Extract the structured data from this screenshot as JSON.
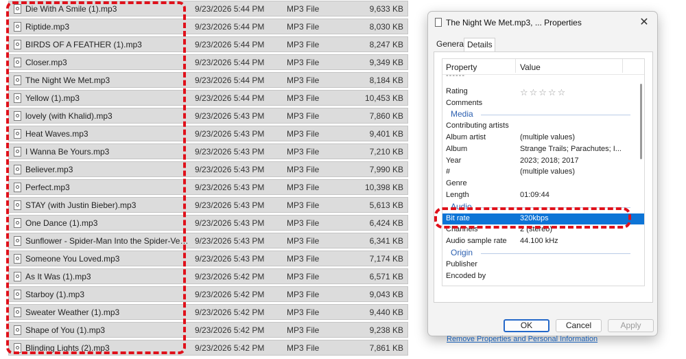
{
  "files": [
    {
      "name": "Die With A Smile (1).mp3",
      "date": "9/23/2026 5:44 PM",
      "type": "MP3 File",
      "size": "9,633 KB"
    },
    {
      "name": "Riptide.mp3",
      "date": "9/23/2026 5:44 PM",
      "type": "MP3 File",
      "size": "8,030 KB"
    },
    {
      "name": "BIRDS OF A FEATHER (1).mp3",
      "date": "9/23/2026 5:44 PM",
      "type": "MP3 File",
      "size": "8,247 KB"
    },
    {
      "name": "Closer.mp3",
      "date": "9/23/2026 5:44 PM",
      "type": "MP3 File",
      "size": "9,349 KB"
    },
    {
      "name": "The Night We Met.mp3",
      "date": "9/23/2026 5:44 PM",
      "type": "MP3 File",
      "size": "8,184 KB"
    },
    {
      "name": "Yellow (1).mp3",
      "date": "9/23/2026 5:44 PM",
      "type": "MP3 File",
      "size": "10,453 KB"
    },
    {
      "name": "lovely (with Khalid).mp3",
      "date": "9/23/2026 5:43 PM",
      "type": "MP3 File",
      "size": "7,860 KB"
    },
    {
      "name": "Heat Waves.mp3",
      "date": "9/23/2026 5:43 PM",
      "type": "MP3 File",
      "size": "9,401 KB"
    },
    {
      "name": "I Wanna Be Yours.mp3",
      "date": "9/23/2026 5:43 PM",
      "type": "MP3 File",
      "size": "7,210 KB"
    },
    {
      "name": "Believer.mp3",
      "date": "9/23/2026 5:43 PM",
      "type": "MP3 File",
      "size": "7,990 KB"
    },
    {
      "name": "Perfect.mp3",
      "date": "9/23/2026 5:43 PM",
      "type": "MP3 File",
      "size": "10,398 KB"
    },
    {
      "name": "STAY (with Justin Bieber).mp3",
      "date": "9/23/2026 5:43 PM",
      "type": "MP3 File",
      "size": "5,613 KB"
    },
    {
      "name": "One Dance (1).mp3",
      "date": "9/23/2026 5:43 PM",
      "type": "MP3 File",
      "size": "6,424 KB"
    },
    {
      "name": "Sunflower - Spider-Man Into the Spider-Verse ...",
      "date": "9/23/2026 5:43 PM",
      "type": "MP3 File",
      "size": "6,341 KB"
    },
    {
      "name": "Someone You Loved.mp3",
      "date": "9/23/2026 5:43 PM",
      "type": "MP3 File",
      "size": "7,174 KB"
    },
    {
      "name": "As It Was (1).mp3",
      "date": "9/23/2026 5:42 PM",
      "type": "MP3 File",
      "size": "6,571 KB"
    },
    {
      "name": "Starboy (1).mp3",
      "date": "9/23/2026 5:42 PM",
      "type": "MP3 File",
      "size": "9,043 KB"
    },
    {
      "name": "Sweater Weather (1).mp3",
      "date": "9/23/2026 5:42 PM",
      "type": "MP3 File",
      "size": "9,440 KB"
    },
    {
      "name": "Shape of You (1).mp3",
      "date": "9/23/2026 5:42 PM",
      "type": "MP3 File",
      "size": "9,238 KB"
    },
    {
      "name": "Blinding Lights (2).mp3",
      "date": "9/23/2026 5:42 PM",
      "type": "MP3 File",
      "size": "7,861 KB"
    }
  ],
  "dialog": {
    "title": "The Night We Met.mp3, ... Properties",
    "close_glyph": "✕",
    "tabs": {
      "general": "General",
      "details": "Details"
    },
    "columns": {
      "property": "Property",
      "value": "Value"
    },
    "rows": [
      {
        "kind": "dashes",
        "name": "------",
        "value": ""
      },
      {
        "kind": "row",
        "name": "Rating",
        "value": "☆☆☆☆☆",
        "stars": true
      },
      {
        "kind": "row",
        "name": "Comments",
        "value": ""
      },
      {
        "kind": "section",
        "name": "Media",
        "value": ""
      },
      {
        "kind": "row",
        "name": "Contributing artists",
        "value": ""
      },
      {
        "kind": "row",
        "name": "Album artist",
        "value": "(multiple values)"
      },
      {
        "kind": "row",
        "name": "Album",
        "value": "Strange Trails; Parachutes; I..."
      },
      {
        "kind": "row",
        "name": "Year",
        "value": "2023; 2018; 2017"
      },
      {
        "kind": "row",
        "name": "#",
        "value": "(multiple values)"
      },
      {
        "kind": "row",
        "name": "Genre",
        "value": ""
      },
      {
        "kind": "row",
        "name": "Length",
        "value": "01:09:44"
      },
      {
        "kind": "section",
        "name": "Audio",
        "value": ""
      },
      {
        "kind": "selected",
        "name": "Bit rate",
        "value": "320kbps"
      },
      {
        "kind": "row",
        "name": "Channels",
        "value": "2 (stereo)"
      },
      {
        "kind": "row",
        "name": "Audio sample rate",
        "value": "44.100 kHz"
      },
      {
        "kind": "section",
        "name": "Origin",
        "value": ""
      },
      {
        "kind": "row",
        "name": "Publisher",
        "value": ""
      },
      {
        "kind": "row",
        "name": "Encoded by",
        "value": ""
      }
    ],
    "remove_link": "Remove Properties and Personal Information",
    "buttons": {
      "ok": "OK",
      "cancel": "Cancel",
      "apply": "Apply"
    }
  },
  "colors": {
    "highlight": "#e0111b",
    "selection": "#0d74d6",
    "link": "#1a5fb4"
  }
}
